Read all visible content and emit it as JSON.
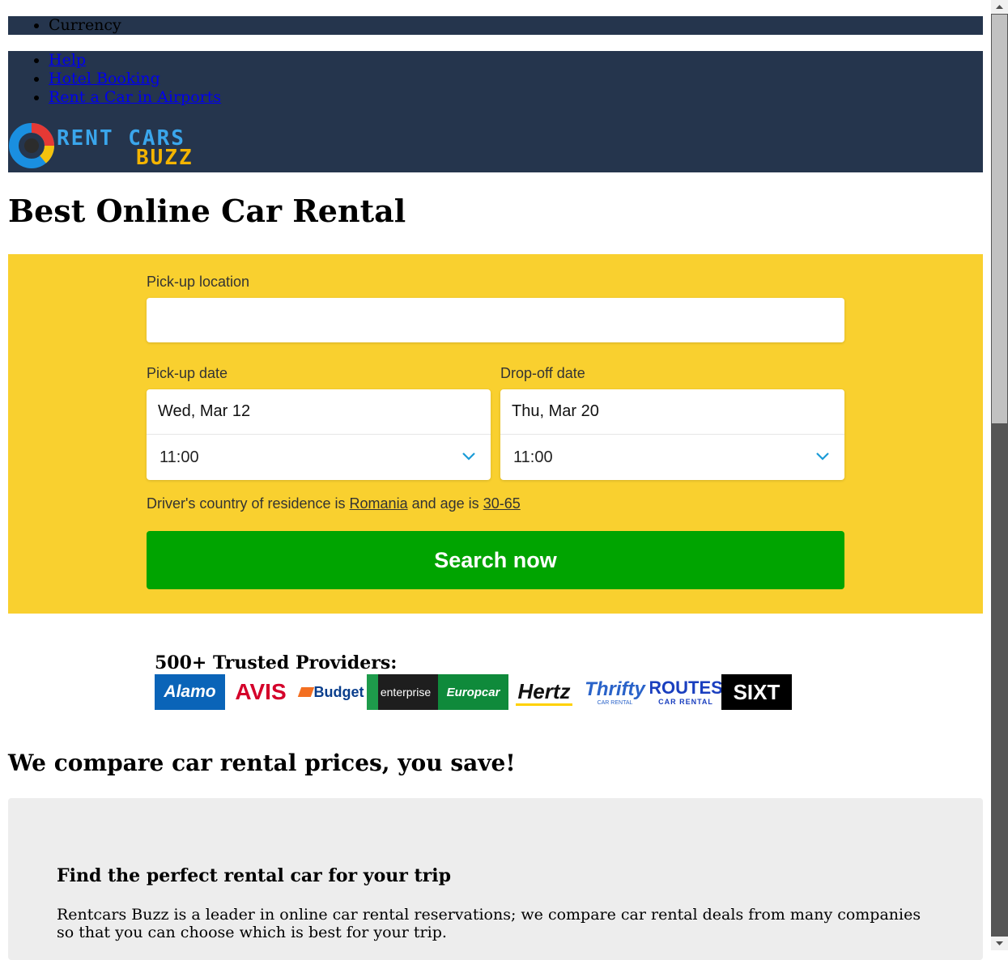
{
  "top_nav": {
    "currency_label": "Currency",
    "links": [
      "Help",
      "Hotel Booking",
      "Rent a Car in Airports"
    ]
  },
  "logo": {
    "line1": "RENT CARS",
    "line2": "BUZZ"
  },
  "page_title": "Best Online Car Rental",
  "search": {
    "pickup_location_label": "Pick-up location",
    "pickup_location_value": "",
    "pickup_date_label": "Pick-up date",
    "pickup_date": "Wed, Mar 12",
    "pickup_time": "11:00",
    "dropoff_date_label": "Drop-off date",
    "dropoff_date": "Thu, Mar 20",
    "dropoff_time": "11:00",
    "driver_prefix": "Driver's country of residence is",
    "driver_country": "Romania",
    "driver_mid": "and age is",
    "driver_age": "30-65",
    "search_button": "Search now"
  },
  "providers": {
    "title": "500+ Trusted Providers:",
    "items": [
      "Alamo",
      "AVIS",
      "Budget",
      "enterprise",
      "Europcar",
      "Hertz",
      "Thrifty",
      "ROUTES",
      "SIXT"
    ],
    "sublabels": {
      "thrifty": "CAR RENTAL",
      "routes": "CAR RENTAL"
    }
  },
  "compare_heading": "We compare car rental prices, you save!",
  "info": {
    "heading": "Find the perfect rental car for your trip",
    "body": "Rentcars Buzz is a leader in online car rental reservations; we compare car rental deals from many companies so that you can choose which is best for your trip."
  },
  "colors": {
    "nav_bg": "#25354d",
    "search_bg": "#f9d02f",
    "search_button": "#00a400",
    "info_bg": "#ededed",
    "chevron": "#1a9bd7"
  }
}
